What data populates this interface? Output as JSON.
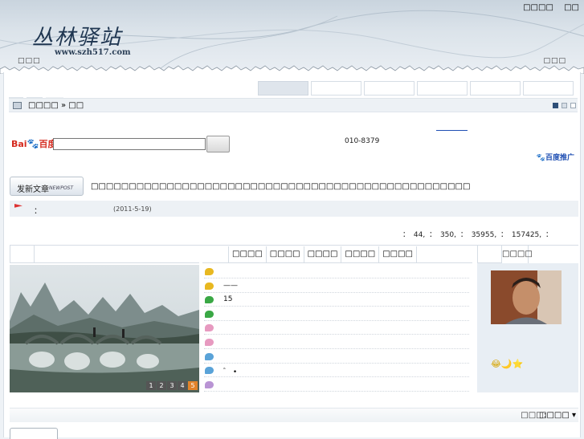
{
  "header": {
    "logo_text": "丛林驿站",
    "logo_url": "www.szh517.com",
    "top_links": [
      "□□□□",
      "□□"
    ],
    "dots_left": "□□□",
    "dots_right": "□□□"
  },
  "breadcrumb": {
    "home": "□□□□",
    "separator": " » ",
    "current": "□□"
  },
  "search": {
    "logo_bai": "Bai",
    "logo_paw": "🐾",
    "logo_du": "百度",
    "phone": "010-8379",
    "promo": "🐾百度推广"
  },
  "newpost": {
    "label": "发新文章",
    "sub": "NEWPOST"
  },
  "notice_text": "□□□□□□□□□□□□□□□□□□□□□□□□□□□□□□□□□□□□□□□□□□□□□□□□□□",
  "announcement": {
    "colon": "：",
    "date": "(2011-5-19)"
  },
  "stats_text": "： 44, ： 350, ： 35955, ： 157425, ：",
  "slideshow": {
    "pages": [
      "1",
      "2",
      "3",
      "4",
      "5"
    ],
    "active_page": "5"
  },
  "mid_tabs": [
    "□□□□",
    "□□□□",
    "□□□□",
    "□□□□",
    "□□□□"
  ],
  "list_rows": [
    {
      "text": "",
      "color": "#e8b820"
    },
    {
      "text": "——",
      "color": "#e8b820"
    },
    {
      "text": "15",
      "color": "#3aa845"
    },
    {
      "text": "",
      "color": "#3aa845"
    },
    {
      "text": "",
      "color": "#e79ac0"
    },
    {
      "text": "",
      "color": "#e79ac0"
    },
    {
      "text": "",
      "color": "#5aa3d8"
    },
    {
      "text": "゛ •",
      "color": "#5aa3d8"
    },
    {
      "text": "",
      "color": "#b994d4"
    }
  ],
  "right_tab": "□□□□",
  "emotes": "😂🌙⭐",
  "footer": {
    "label": "□□□:",
    "dropdown": "□□□□ ▾"
  }
}
